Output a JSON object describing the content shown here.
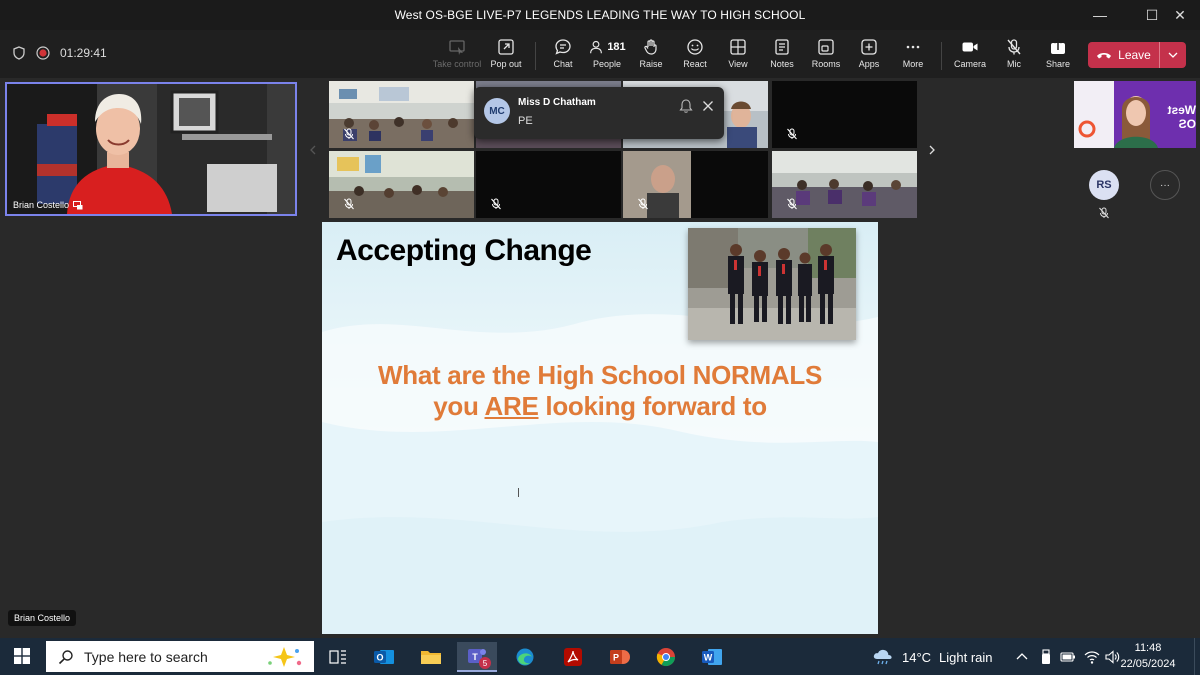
{
  "window": {
    "title": "West OS-BGE LIVE-P7 LEGENDS LEADING THE WAY TO HIGH SCHOOL",
    "minimize": "—",
    "maximize": "☐",
    "close": "✕"
  },
  "meeting": {
    "timer": "01:29:41",
    "people_count": "181"
  },
  "toolbar": {
    "take_control": "Take control",
    "pop_out": "Pop out",
    "chat": "Chat",
    "people": "People",
    "raise": "Raise",
    "react": "React",
    "view": "View",
    "notes": "Notes",
    "rooms": "Rooms",
    "apps": "Apps",
    "more": "More",
    "camera": "Camera",
    "mic": "Mic",
    "share": "Share",
    "leave": "Leave"
  },
  "presenter": {
    "name": "Brian Costello"
  },
  "notification": {
    "initials": "MC",
    "name": "Miss D Chatham",
    "message": "PE"
  },
  "side_panel": {
    "thumb_text": "West OS",
    "avatar_initials": "RS",
    "more": "···"
  },
  "slide": {
    "title": "Accepting Change",
    "line1": "What are the High School NORMALS",
    "line2_pre": "you ",
    "line2_emph": "ARE",
    "line2_post": " looking forward to"
  },
  "taskbar": {
    "search_placeholder": "Type here to search",
    "weather_temp": "14°C",
    "weather_desc": "Light rain",
    "time": "11:48",
    "date": "22/05/2024",
    "teams_badge": "5"
  },
  "colors": {
    "leave_red": "#c4314b",
    "slide_orange": "#e07b39",
    "selection_border": "#7b83eb",
    "taskbar_bg": "#1b2a3a"
  }
}
